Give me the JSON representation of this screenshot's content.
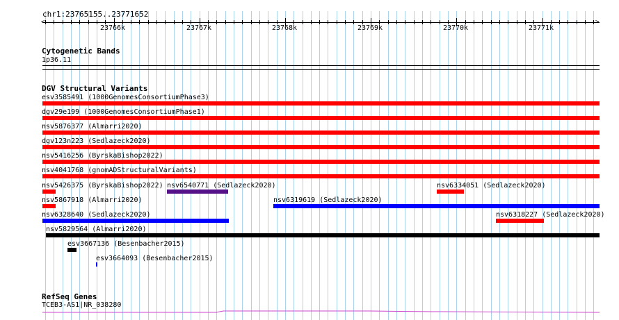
{
  "location": "chr1:23765155..23771652",
  "ruler": {
    "ticks": [
      "23766k",
      "23767k",
      "23768k",
      "23769k",
      "23770k",
      "23771k"
    ]
  },
  "colors": {
    "deletion": "#ff0000",
    "duplication": "#0000ff",
    "complex": "#551188",
    "other": "#000000",
    "gene": "#cc44cc",
    "grid": "#a9d4ec"
  },
  "tracks": {
    "cytoband": {
      "title": "Cytogenetic Bands",
      "band": "1p36.11"
    },
    "dgv": {
      "title": "DGV Structural Variants",
      "variants": [
        {
          "label": "esv3585491 (1000GenomesConsortiumPhase3)",
          "color": "deletion"
        },
        {
          "label": "dgv29e199 (1000GenomesConsortiumPhase1)",
          "color": "deletion"
        },
        {
          "label": "nsv5876377 (Almarri2020)",
          "color": "deletion"
        },
        {
          "label": "dgv123n223 (Sedlazeck2020)",
          "color": "deletion"
        },
        {
          "label": "nsv5416256 (ByrskaBishop2022)",
          "color": "deletion"
        },
        {
          "label": "nsv4041768 (gnomADStructuralVariants)",
          "color": "deletion"
        },
        {
          "label": "nsv5426375 (ByrskaBishop2022)",
          "color": "deletion"
        },
        {
          "label": "nsv6540771 (Sedlazeck2020)",
          "color": "complex"
        },
        {
          "label": "nsv6334051 (Sedlazeck2020)",
          "color": "deletion"
        },
        {
          "label": "nsv5867918 (Almarri2020)",
          "color": "deletion"
        },
        {
          "label": "nsv6319619 (Sedlazeck2020)",
          "color": "duplication"
        },
        {
          "label": "nsv6328640 (Sedlazeck2020)",
          "color": "duplication"
        },
        {
          "label": "nsv6318227 (Sedlazeck2020)",
          "color": "deletion"
        },
        {
          "label": "nsv5829564 (Almarri2020)",
          "color": "other"
        },
        {
          "label": "esv3667136 (Besenbacher2015)",
          "color": "other"
        },
        {
          "label": "esv3664093 (Besenbacher2015)",
          "color": "duplication"
        }
      ]
    },
    "refseq": {
      "title": "RefSeq Genes",
      "gene": "TCEB3-AS1|NR_038280"
    }
  }
}
